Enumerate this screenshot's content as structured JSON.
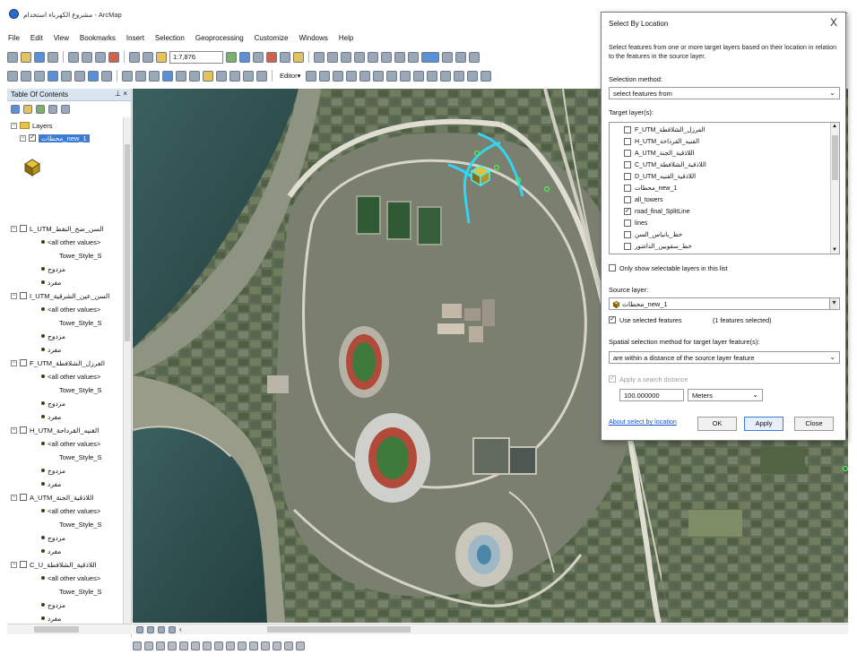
{
  "window": {
    "title": "مشروع الكهرباء استخدام - ArcMap"
  },
  "menu": [
    "File",
    "Edit",
    "View",
    "Bookmarks",
    "Insert",
    "Selection",
    "Geoprocessing",
    "Customize",
    "Windows",
    "Help"
  ],
  "toolbar": {
    "scale": "1:7,876",
    "editor_label": "Editor▾"
  },
  "toc": {
    "title": "Table Of Contents",
    "pin": "⊥ ×",
    "root": "Layers",
    "selected_layer": "محطات_new_1",
    "layers": [
      {
        "name": "L_UTM_السن_ضخ_النفط",
        "values": [
          "<all other values>",
          "Towe_Style_S",
          "مزدوج",
          "مفرد"
        ]
      },
      {
        "name": "I_UTM_السن_عين_الشرقية",
        "values": [
          "<all other values>",
          "Towe_Style_S",
          "مزدوج",
          "مفرد"
        ]
      },
      {
        "name": "F_UTM_الفرزل_الشلافطة",
        "values": [
          "<all other values>",
          "Towe_Style_S",
          "مزدوج",
          "مفرد"
        ]
      },
      {
        "name": "H_UTM_القنيه_القرداحة",
        "values": [
          "<all other values>",
          "Towe_Style_S",
          "مزدوج",
          "مفرد"
        ]
      },
      {
        "name": "A_UTM_اللاذقية_الجنة",
        "values": [
          "<all other values>",
          "Towe_Style_S",
          "مزدوج",
          "مفرد"
        ]
      },
      {
        "name": "C_U_اللاذقية_الشلافطة",
        "values": [
          "<all other values>",
          "Towe_Style_S",
          "مزدوج",
          "مفرد"
        ]
      },
      {
        "name": "D_UTM_اللاذقية_القنيه",
        "values": []
      }
    ]
  },
  "dialog": {
    "title": "Select By Location",
    "close": "X",
    "description": "Select features from one or more target layers based on their location in relation to the features in the source layer.",
    "selection_method_label": "Selection method:",
    "selection_method": "select features from",
    "target_layers_label": "Target layer(s):",
    "target_layers": [
      {
        "name": "F_UTM_الفرزل_الشلافطة",
        "checked": false
      },
      {
        "name": "H_UTM_القنيه_القرداحة",
        "checked": false
      },
      {
        "name": "A_UTM_اللاذقية_الجنة",
        "checked": false
      },
      {
        "name": "C_UTM_اللاذقية_الشلافطة",
        "checked": false
      },
      {
        "name": "D_UTM_اللاذقية_القنيه",
        "checked": false
      },
      {
        "name": "محطات_new_1",
        "checked": false
      },
      {
        "name": "all_towers",
        "checked": false
      },
      {
        "name": "road_final_SplitLine",
        "checked": true
      },
      {
        "name": "lines",
        "checked": false
      },
      {
        "name": "خط_بانياس_السن",
        "checked": false
      },
      {
        "name": "خط_سقوبين_الداشور",
        "checked": false
      }
    ],
    "only_selectable": "Only show selectable layers in this list",
    "source_layer_label": "Source layer:",
    "source_layer": "محطات_new_1",
    "use_selected": "Use selected features",
    "features_selected": "(1 features selected)",
    "spatial_method_label": "Spatial selection method for target layer feature(s):",
    "spatial_method": "are within a distance of the source layer feature",
    "apply_search_distance": "Apply a search distance",
    "distance_value": "100.000000",
    "distance_unit": "Meters",
    "about_link": "About select by location",
    "ok": "OK",
    "apply": "Apply",
    "close_button": "Close"
  },
  "colors": {
    "selection": "#3d7cd1",
    "highlight_road": "#32d5f2",
    "link": "#1a4fc7"
  }
}
